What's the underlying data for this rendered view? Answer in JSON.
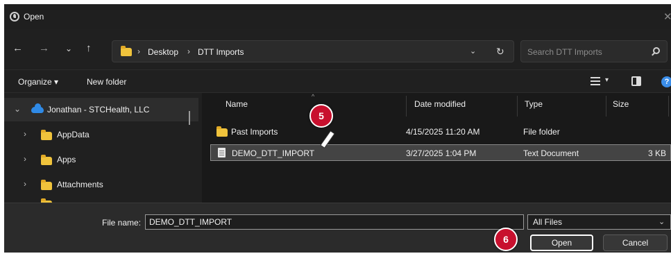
{
  "window": {
    "title": "Open"
  },
  "nav": {
    "back": "←",
    "forward": "→",
    "recent": "⌄",
    "up": "↑"
  },
  "address": {
    "separator": "›",
    "crumbs": [
      "Desktop",
      "DTT Imports"
    ],
    "dropdown": "⌄",
    "refresh": "↻"
  },
  "search": {
    "placeholder": "Search DTT Imports"
  },
  "toolbar": {
    "organize": "Organize ▾",
    "new_folder": "New folder",
    "view_menu": "▾",
    "help": "?"
  },
  "nav_pane": {
    "items": [
      {
        "label": "Jonathan - STCHealth, LLC",
        "chevron": "⌄"
      },
      {
        "label": "AppData",
        "chevron": "›"
      },
      {
        "label": "Apps",
        "chevron": "›"
      },
      {
        "label": "Attachments",
        "chevron": "›"
      }
    ]
  },
  "file_list": {
    "columns": [
      "Name",
      "Date modified",
      "Type",
      "Size"
    ],
    "sort_indicator": "^",
    "rows": [
      {
        "name": "Past Imports",
        "date": "4/15/2025 11:20 AM",
        "type": "File folder",
        "size": ""
      },
      {
        "name": "DEMO_DTT_IMPORT",
        "date": "3/27/2025 1:04 PM",
        "type": "Text Document",
        "size": "3 KB"
      }
    ]
  },
  "bottom": {
    "file_name_label": "File name:",
    "file_name_value": "DEMO_DTT_IMPORT",
    "file_name_dropdown": "⌄",
    "file_type_value": "All Files",
    "file_type_dropdown": "⌄",
    "open_label": "Open",
    "cancel_label": "Cancel"
  },
  "callouts": {
    "step5": "5",
    "step6": "6"
  },
  "colors": {
    "folder": "#f0c33c",
    "callout": "#c8102e",
    "onedrive": "#2f8ae6",
    "help": "#3b8eea"
  }
}
